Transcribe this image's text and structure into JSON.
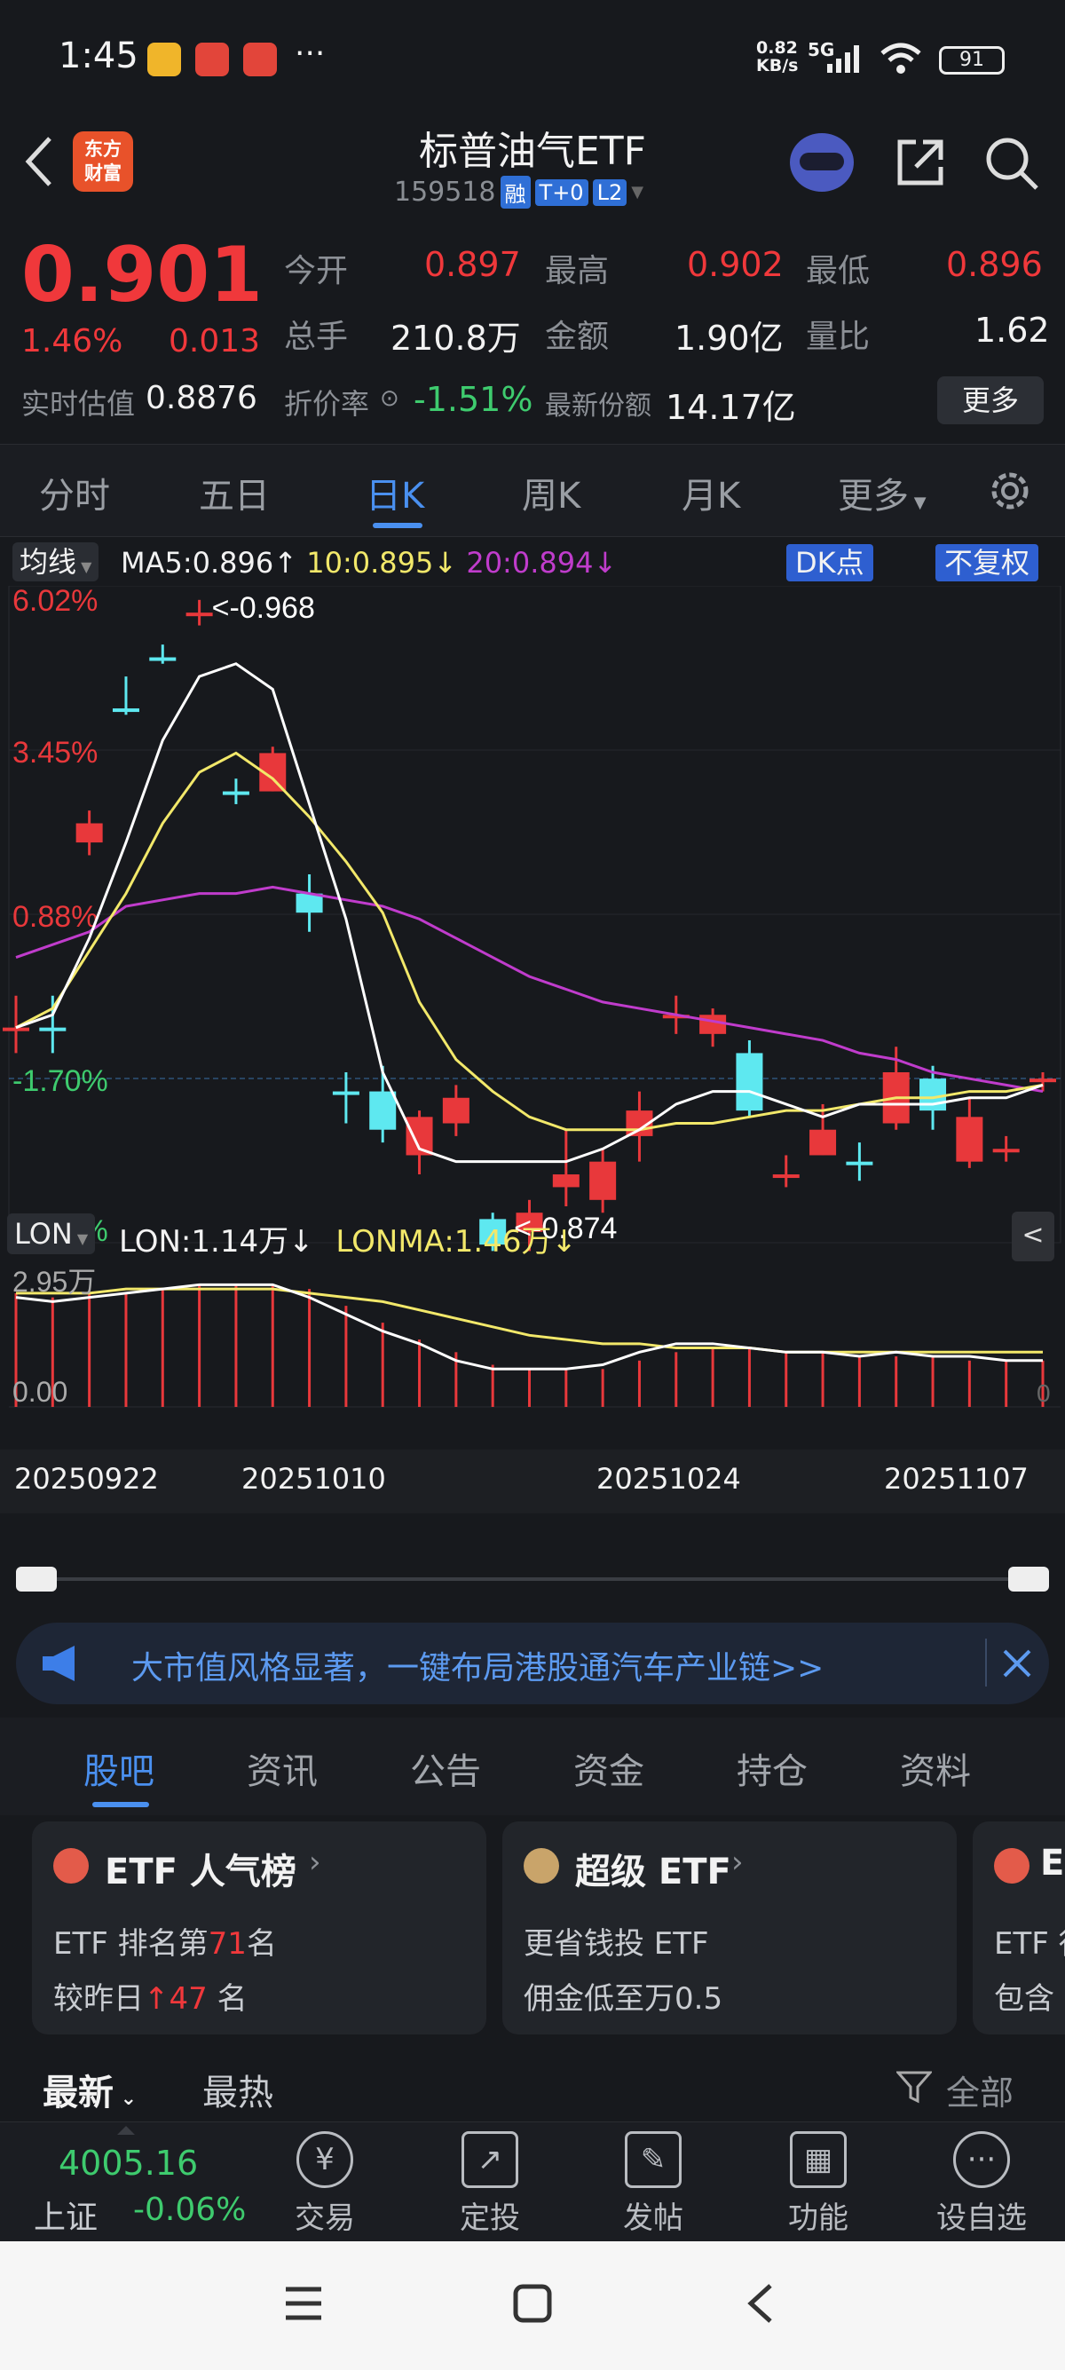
{
  "status": {
    "time": "1:45",
    "dots": "···",
    "speed": "0.82",
    "speed_unit": "KB/s",
    "net": "5G",
    "battery": "91"
  },
  "header": {
    "title": "标普油气ETF",
    "code": "159518",
    "badges": [
      "融",
      "T+0",
      "L2"
    ],
    "logo_line1": "东方",
    "logo_line2": "财富"
  },
  "quote": {
    "price": "0.901",
    "change_pct": "1.46%",
    "change": "0.013",
    "est_label": "实时估值",
    "est_value": "0.8876",
    "open_label": "今开",
    "open": "0.897",
    "high_label": "最高",
    "high": "0.902",
    "low_label": "最低",
    "low": "0.896",
    "vol_label": "总手",
    "vol": "210.8万",
    "amt_label": "金额",
    "amt": "1.90亿",
    "ratio_label": "量比",
    "ratio": "1.62",
    "disc_label": "折价率",
    "disc": "-1.51%",
    "share_label": "最新份额",
    "share": "14.17亿",
    "more": "更多"
  },
  "tabs": [
    "分时",
    "五日",
    "日K",
    "周K",
    "月K",
    "更多"
  ],
  "chart": {
    "ma_label": "均线",
    "ma5": "MA5:0.896↑",
    "ma10": "10:0.895↓",
    "ma20": "20:0.894↓",
    "dk_btn": "DK点",
    "fq_btn": "不复权",
    "y_labels": [
      "6.02%",
      "3.45%",
      "0.88%",
      "-1.70%",
      "-4.27%"
    ],
    "hi_mark": "<-0.968",
    "lo_mark": "<-0.874",
    "lon_label": "LON",
    "lon_value": "LON:1.14万↓",
    "lonma_value": "LONMA:1.46万↓",
    "sub_y_top": "2.95万",
    "sub_y_bottom": "0.00",
    "sub_right_zero": "0",
    "dates": [
      "20250922",
      "20251010",
      "20251024",
      "20251107"
    ],
    "colors": {
      "up": "#e8383b",
      "down": "#5ee8f0",
      "ma5": "#ffffff",
      "ma10": "#f2e86a",
      "ma20": "#c03ccc"
    }
  },
  "chart_data": {
    "type": "candlestick",
    "ylim_pct": [
      -4.27,
      6.02
    ],
    "candles": [
      {
        "o": -0.9,
        "c": -0.9,
        "h": -0.4,
        "l": -1.3,
        "up": true
      },
      {
        "o": -0.9,
        "c": -0.9,
        "h": -0.4,
        "l": -1.3,
        "up": false
      },
      {
        "o": 2.0,
        "c": 2.3,
        "h": 2.5,
        "l": 1.8,
        "up": true
      },
      {
        "o": 4.1,
        "c": 4.1,
        "h": 4.6,
        "l": 4.0,
        "up": false
      },
      {
        "o": 4.9,
        "c": 4.9,
        "h": 5.1,
        "l": 4.8,
        "up": false
      },
      {
        "o": 5.6,
        "c": 5.6,
        "h": 5.8,
        "l": 5.4,
        "up": true
      },
      {
        "o": 2.8,
        "c": 2.8,
        "h": 3.0,
        "l": 2.6,
        "up": false
      },
      {
        "o": 2.8,
        "c": 3.4,
        "h": 3.5,
        "l": 2.8,
        "up": true
      },
      {
        "o": 0.9,
        "c": 1.2,
        "h": 1.5,
        "l": 0.6,
        "up": false
      },
      {
        "o": -1.9,
        "c": -1.9,
        "h": -1.6,
        "l": -2.4,
        "up": false
      },
      {
        "o": -1.9,
        "c": -2.5,
        "h": -1.5,
        "l": -2.7,
        "up": false
      },
      {
        "o": -2.3,
        "c": -2.9,
        "h": -2.2,
        "l": -3.2,
        "up": true
      },
      {
        "o": -2.0,
        "c": -2.4,
        "h": -1.8,
        "l": -2.6,
        "up": true
      },
      {
        "o": -3.9,
        "c": -4.3,
        "h": -3.8,
        "l": -4.4,
        "up": false
      },
      {
        "o": -3.8,
        "c": -4.1,
        "h": -3.6,
        "l": -4.4,
        "up": true
      },
      {
        "o": -3.2,
        "c": -3.4,
        "h": -2.5,
        "l": -3.7,
        "up": true
      },
      {
        "o": -3.0,
        "c": -3.6,
        "h": -2.8,
        "l": -3.8,
        "up": true
      },
      {
        "o": -2.2,
        "c": -2.6,
        "h": -1.9,
        "l": -3.0,
        "up": true
      },
      {
        "o": -0.7,
        "c": -0.7,
        "h": -0.4,
        "l": -1.0,
        "up": true
      },
      {
        "o": -1.0,
        "c": -0.7,
        "h": -0.6,
        "l": -1.2,
        "up": true
      },
      {
        "o": -1.3,
        "c": -2.2,
        "h": -1.1,
        "l": -2.3,
        "up": false
      },
      {
        "o": -3.2,
        "c": -3.2,
        "h": -2.9,
        "l": -3.4,
        "up": true
      },
      {
        "o": -2.5,
        "c": -2.9,
        "h": -2.1,
        "l": -2.9,
        "up": true
      },
      {
        "o": -3.0,
        "c": -3.0,
        "h": -2.7,
        "l": -3.3,
        "up": false
      },
      {
        "o": -1.6,
        "c": -2.4,
        "h": -1.2,
        "l": -2.5,
        "up": true
      },
      {
        "o": -1.7,
        "c": -2.2,
        "h": -1.5,
        "l": -2.5,
        "up": false
      },
      {
        "o": -2.3,
        "c": -3.0,
        "h": -2.0,
        "l": -3.1,
        "up": true
      },
      {
        "o": -2.8,
        "c": -2.8,
        "h": -2.6,
        "l": -3.0,
        "up": true
      },
      {
        "o": -1.7,
        "c": -1.7,
        "h": -1.6,
        "l": -1.9,
        "up": true
      }
    ],
    "ma5": [
      -0.9,
      -0.7,
      0.5,
      2.0,
      3.6,
      4.6,
      4.8,
      4.4,
      2.6,
      0.8,
      -1.6,
      -2.8,
      -3.0,
      -3.0,
      -3.0,
      -3.0,
      -2.8,
      -2.5,
      -2.1,
      -1.9,
      -1.9,
      -2.1,
      -2.3,
      -2.1,
      -2.1,
      -2.1,
      -2.0,
      -2.0,
      -1.8
    ],
    "ma10": [
      -0.9,
      -0.6,
      0.3,
      1.2,
      2.3,
      3.1,
      3.4,
      3.0,
      2.4,
      1.7,
      0.9,
      -0.5,
      -1.4,
      -1.9,
      -2.3,
      -2.5,
      -2.5,
      -2.5,
      -2.4,
      -2.4,
      -2.3,
      -2.2,
      -2.2,
      -2.1,
      -2.0,
      -2.0,
      -1.9,
      -1.9,
      -1.8
    ],
    "ma20": [
      0.2,
      0.4,
      0.6,
      1.0,
      1.1,
      1.2,
      1.2,
      1.3,
      1.2,
      1.1,
      1.0,
      0.8,
      0.5,
      0.2,
      -0.1,
      -0.3,
      -0.5,
      -0.6,
      -0.7,
      -0.8,
      -0.9,
      -1.0,
      -1.1,
      -1.3,
      -1.4,
      -1.6,
      -1.7,
      -1.8,
      -1.9
    ],
    "lon_bars": [
      2.7,
      2.6,
      2.7,
      2.7,
      2.8,
      2.9,
      2.9,
      2.9,
      2.8,
      2.4,
      2.0,
      1.6,
      1.3,
      1.0,
      0.9,
      0.9,
      0.9,
      1.1,
      1.3,
      1.4,
      1.4,
      1.3,
      1.3,
      1.2,
      1.2,
      1.2,
      1.1,
      1.1,
      1.1
    ],
    "lon": [
      2.6,
      2.5,
      2.6,
      2.7,
      2.8,
      2.9,
      2.9,
      2.9,
      2.6,
      2.2,
      1.8,
      1.5,
      1.1,
      0.9,
      0.9,
      0.9,
      1.0,
      1.3,
      1.5,
      1.5,
      1.4,
      1.3,
      1.3,
      1.2,
      1.3,
      1.2,
      1.2,
      1.1,
      1.1
    ],
    "lonma": [
      2.7,
      2.7,
      2.7,
      2.8,
      2.8,
      2.8,
      2.8,
      2.8,
      2.7,
      2.6,
      2.5,
      2.3,
      2.1,
      1.9,
      1.7,
      1.6,
      1.5,
      1.5,
      1.4,
      1.4,
      1.4,
      1.3,
      1.3,
      1.3,
      1.3,
      1.3,
      1.3,
      1.3,
      1.3
    ]
  },
  "notice": {
    "text": "大市值风格显著，一键布局港股通汽车产业链>>"
  },
  "section_tabs": [
    "股吧",
    "资讯",
    "公告",
    "资金",
    "持仓",
    "资料"
  ],
  "cards": [
    {
      "title": "ETF 人气榜",
      "l1_pre": "ETF 排名第",
      "l1_num": "71",
      "l1_post": "名",
      "l2_pre": "较昨日",
      "l2_num": "47",
      "l2_post": "名"
    },
    {
      "title": "超级 ETF",
      "l1": "更省钱投 ETF",
      "l2": "佣金低至万0.5"
    },
    {
      "title": "E",
      "l1": "ETF 行",
      "l2": "包含"
    }
  ],
  "sorts": {
    "latest": "最新",
    "hot": "最热",
    "all": "全部"
  },
  "bottom": {
    "index_value": "4005.16",
    "index_name": "上证",
    "index_change": "-0.06%",
    "items": [
      {
        "icon": "¥",
        "label": "交易"
      },
      {
        "icon": "↗",
        "label": "定投"
      },
      {
        "icon": "✎",
        "label": "发帖"
      },
      {
        "icon": "▦",
        "label": "功能"
      },
      {
        "icon": "···",
        "label": "设自选"
      }
    ]
  }
}
